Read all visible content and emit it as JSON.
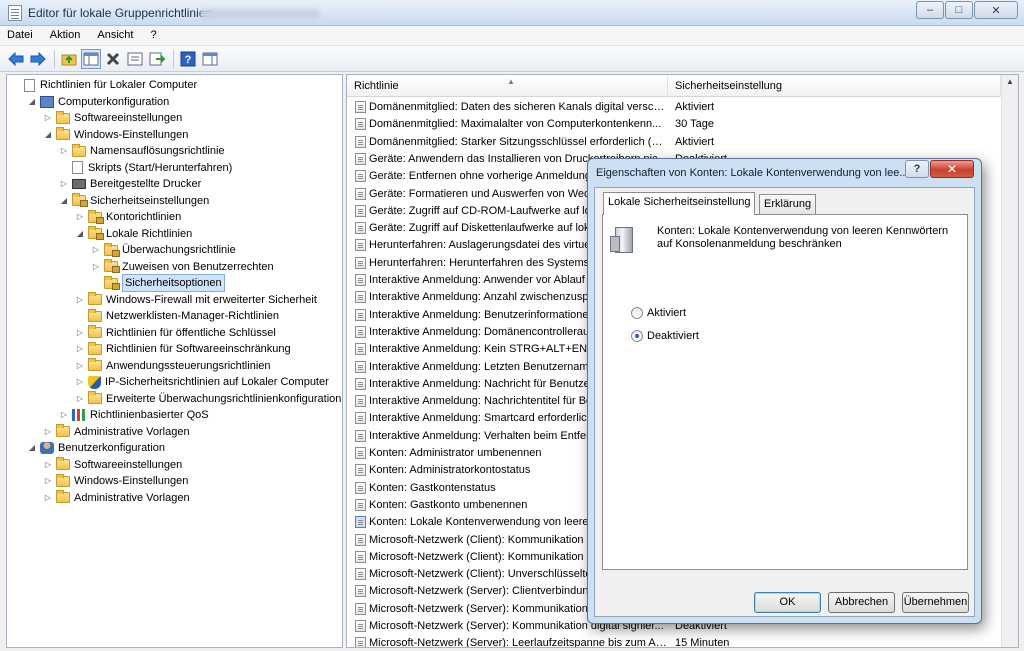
{
  "window": {
    "title": "Editor für lokale Gruppenrichtlinien"
  },
  "menu": {
    "items": [
      "Datei",
      "Aktion",
      "Ansicht",
      "?"
    ]
  },
  "tree": {
    "items": [
      {
        "label": "Richtlinien für Lokaler Computer",
        "level": 0,
        "icon": "doc-icon",
        "expander": ""
      },
      {
        "label": "Computerkonfiguration",
        "level": 1,
        "icon": "computer-icon",
        "expander": "expanded"
      },
      {
        "label": "Softwareeinstellungen",
        "level": 2,
        "icon": "folder-icon",
        "expander": "collapsed"
      },
      {
        "label": "Windows-Einstellungen",
        "level": 2,
        "icon": "folder-icon",
        "expander": "expanded"
      },
      {
        "label": "Namensauflösungsrichtlinie",
        "level": 3,
        "icon": "folder-icon",
        "expander": "collapsed"
      },
      {
        "label": "Skripts (Start/Herunterfahren)",
        "level": 3,
        "icon": "doc-icon",
        "expander": ""
      },
      {
        "label": "Bereitgestellte Drucker",
        "level": 3,
        "icon": "printer-icon",
        "expander": "collapsed"
      },
      {
        "label": "Sicherheitseinstellungen",
        "level": 3,
        "icon": "lock-folder-icon",
        "expander": "expanded"
      },
      {
        "label": "Kontorichtlinien",
        "level": 4,
        "icon": "lock-folder-icon",
        "expander": "collapsed"
      },
      {
        "label": "Lokale Richtlinien",
        "level": 4,
        "icon": "lock-folder-icon",
        "expander": "expanded"
      },
      {
        "label": "Überwachungsrichtlinie",
        "level": 5,
        "icon": "lock-folder-icon",
        "expander": "collapsed"
      },
      {
        "label": "Zuweisen von Benutzerrechten",
        "level": 5,
        "icon": "lock-folder-icon",
        "expander": "collapsed"
      },
      {
        "label": "Sicherheitsoptionen",
        "level": 5,
        "icon": "lock-folder-icon",
        "expander": "",
        "selected": true
      },
      {
        "label": "Windows-Firewall mit erweiterter Sicherheit",
        "level": 4,
        "icon": "folder-icon",
        "expander": "collapsed"
      },
      {
        "label": "Netzwerklisten-Manager-Richtlinien",
        "level": 4,
        "icon": "folder-icon",
        "expander": ""
      },
      {
        "label": "Richtlinien für öffentliche Schlüssel",
        "level": 4,
        "icon": "folder-icon",
        "expander": "collapsed"
      },
      {
        "label": "Richtlinien für Softwareeinschränkung",
        "level": 4,
        "icon": "folder-icon",
        "expander": "collapsed"
      },
      {
        "label": "Anwendungssteuerungsrichtlinien",
        "level": 4,
        "icon": "folder-icon",
        "expander": "collapsed"
      },
      {
        "label": "IP-Sicherheitsrichtlinien auf Lokaler Computer",
        "level": 4,
        "icon": "shield-icon",
        "expander": "collapsed"
      },
      {
        "label": "Erweiterte Überwachungsrichtlinienkonfiguration",
        "level": 4,
        "icon": "folder-icon",
        "expander": "collapsed"
      },
      {
        "label": "Richtlinienbasierter QoS",
        "level": 3,
        "icon": "chart-icon",
        "expander": "collapsed"
      },
      {
        "label": "Administrative Vorlagen",
        "level": 2,
        "icon": "folder-icon",
        "expander": "collapsed"
      },
      {
        "label": "Benutzerkonfiguration",
        "level": 1,
        "icon": "user-icon",
        "expander": "expanded"
      },
      {
        "label": "Softwareeinstellungen",
        "level": 2,
        "icon": "folder-icon",
        "expander": "collapsed"
      },
      {
        "label": "Windows-Einstellungen",
        "level": 2,
        "icon": "folder-icon",
        "expander": "collapsed"
      },
      {
        "label": "Administrative Vorlagen",
        "level": 2,
        "icon": "folder-icon",
        "expander": "collapsed"
      }
    ]
  },
  "list": {
    "columns": [
      "Richtlinie",
      "Sicherheitseinstellung"
    ],
    "rows": [
      {
        "policy": "Domänenmitglied: Daten des sicheren Kanals digital verschl...",
        "setting": "Aktiviert"
      },
      {
        "policy": "Domänenmitglied: Maximalalter von Computerkontenkenn...",
        "setting": "30 Tage"
      },
      {
        "policy": "Domänenmitglied: Starker Sitzungsschlüssel erforderlich (Wi...",
        "setting": "Aktiviert"
      },
      {
        "policy": "Geräte: Anwendern das Installieren von Druckertreibern nich...",
        "setting": "Deaktiviert"
      },
      {
        "policy": "Geräte: Entfernen ohne vorherige Anmeldung",
        "setting": ""
      },
      {
        "policy": "Geräte: Formatieren und Auswerfen von Wechselmedien",
        "setting": ""
      },
      {
        "policy": "Geräte: Zugriff auf CD-ROM-Laufwerke auf lokale Benutzer",
        "setting": ""
      },
      {
        "policy": "Geräte: Zugriff auf Diskettenlaufwerke auf lokale Benutzer",
        "setting": ""
      },
      {
        "policy": "Herunterfahren: Auslagerungsdatei des virtuellen Arbeitsspe",
        "setting": ""
      },
      {
        "policy": "Herunterfahren: Herunterfahren des Systems ohne Anmeld",
        "setting": ""
      },
      {
        "policy": "Interaktive Anmeldung: Anwender vor Ablauf des Kennworts",
        "setting": ""
      },
      {
        "policy": "Interaktive Anmeldung: Anzahl zwischenzuspeichernder",
        "setting": ""
      },
      {
        "policy": "Interaktive Anmeldung: Benutzerinformationen anzeigen",
        "setting": ""
      },
      {
        "policy": "Interaktive Anmeldung: Domänencontrollerauthentifizierung",
        "setting": ""
      },
      {
        "policy": "Interaktive Anmeldung: Kein STRG+ALT+ENTF erforderlich",
        "setting": ""
      },
      {
        "policy": "Interaktive Anmeldung: Letzten Benutzernamen nicht anzeigen",
        "setting": ""
      },
      {
        "policy": "Interaktive Anmeldung: Nachricht für Benutzer",
        "setting": ""
      },
      {
        "policy": "Interaktive Anmeldung: Nachrichtentitel für Benutzer",
        "setting": ""
      },
      {
        "policy": "Interaktive Anmeldung: Smartcard erforderlich",
        "setting": ""
      },
      {
        "policy": "Interaktive Anmeldung: Verhalten beim Entfernen",
        "setting": ""
      },
      {
        "policy": "Konten: Administrator umbenennen",
        "setting": ""
      },
      {
        "policy": "Konten: Administratorkontostatus",
        "setting": ""
      },
      {
        "policy": "Konten: Gastkontenstatus",
        "setting": ""
      },
      {
        "policy": "Konten: Gastkonto umbenennen",
        "setting": ""
      },
      {
        "policy": "Konten: Lokale Kontenverwendung von leeren Kennwörtern",
        "setting": "",
        "selected": true
      },
      {
        "policy": "Microsoft-Netzwerk (Client): Kommunikation digital signieren",
        "setting": ""
      },
      {
        "policy": "Microsoft-Netzwerk (Client): Kommunikation digital signieren",
        "setting": ""
      },
      {
        "policy": "Microsoft-Netzwerk (Client): Unverschlüsseltes Kennwort",
        "setting": ""
      },
      {
        "policy": "Microsoft-Netzwerk (Server): Clientverbindungen trennen",
        "setting": ""
      },
      {
        "policy": "Microsoft-Netzwerk (Server): Kommunikation digital signieren",
        "setting": ""
      },
      {
        "policy": "Microsoft-Netzwerk (Server): Kommunikation digital signier...",
        "setting": "Deaktiviert"
      },
      {
        "policy": "Microsoft-Netzwerk (Server): Leerlaufzeitspanne bis zum An...",
        "setting": "15 Minuten"
      }
    ]
  },
  "dialog": {
    "title": "Eigenschaften von Konten: Lokale Kontenverwendung von lee...",
    "help_label": "?",
    "close_label": "✕",
    "tabs": [
      "Lokale Sicherheitseinstellung",
      "Erklärung"
    ],
    "description": "Konten: Lokale Kontenverwendung von leeren Kennwörtern auf Konsolenanmeldung beschränken",
    "options": [
      {
        "label": "Aktiviert",
        "checked": false
      },
      {
        "label": "Deaktiviert",
        "checked": true
      }
    ],
    "buttons": {
      "ok": "OK",
      "cancel": "Abbrechen",
      "apply": "Übernehmen"
    }
  },
  "caption": {
    "minimize": "–",
    "maximize": "□",
    "close": "✕"
  },
  "colors": {
    "accent": "#3c7fb1",
    "selection": "#cfe3fc",
    "dialog_frame": "#cde0f3"
  }
}
